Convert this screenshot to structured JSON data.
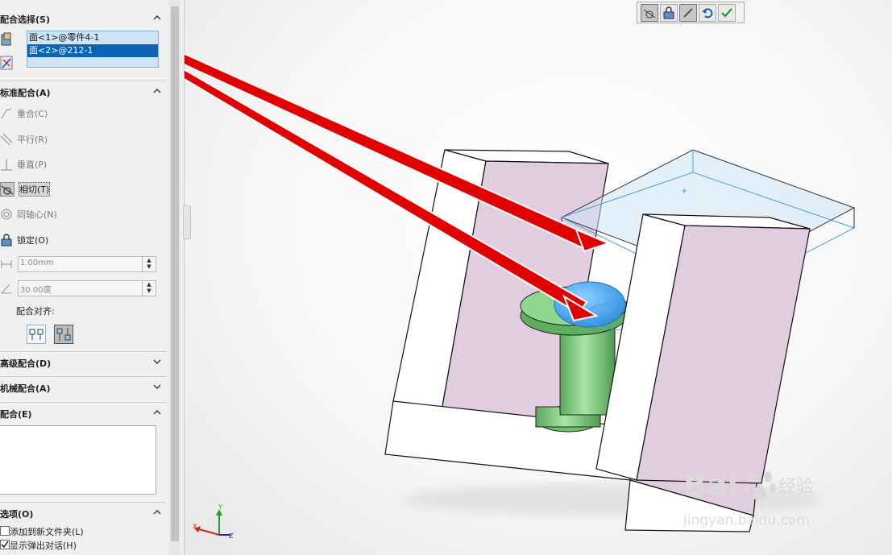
{
  "panel": {
    "mate_selection": {
      "title": "配合选择(S)",
      "items": [
        "面<1>@零件4-1",
        "面<2>@212-1"
      ]
    },
    "standard_mates": {
      "title": "标准配合(A)",
      "items": [
        {
          "label": "重合(C)",
          "icon": "coincident-icon"
        },
        {
          "label": "平行(R)",
          "icon": "parallel-icon"
        },
        {
          "label": "垂直(P)",
          "icon": "perpendicular-icon"
        },
        {
          "label": "相切(T)",
          "icon": "tangent-icon"
        },
        {
          "label": "同轴心(N)",
          "icon": "concentric-icon"
        },
        {
          "label": "锁定(O)",
          "icon": "lock-icon"
        }
      ],
      "distance_value": "1.00mm",
      "angle_value": "30.00度",
      "alignment_label": "配合对齐:"
    },
    "advanced_mates": {
      "title": "高级配合(D)"
    },
    "mechanical_mates": {
      "title": "机械配合(A)"
    },
    "mates": {
      "title": "配合(E)"
    },
    "options": {
      "title": "选项(O)",
      "add_to_folder_label": "添加到新文件夹(L)",
      "show_popup_label": "显示弹出对话(H)"
    }
  },
  "watermark": {
    "brand_text": "Bai",
    "brand_text2": "du",
    "brand_cn": "经验",
    "url": "jingyan.baidu.com"
  },
  "colors": {
    "accent": "#0a64b4",
    "part_face": "#e2cde0",
    "cylinder": "#7dc97d",
    "dome": "#4aa4ee",
    "plate": "#cfe6f6",
    "arrow": "#e00000"
  }
}
